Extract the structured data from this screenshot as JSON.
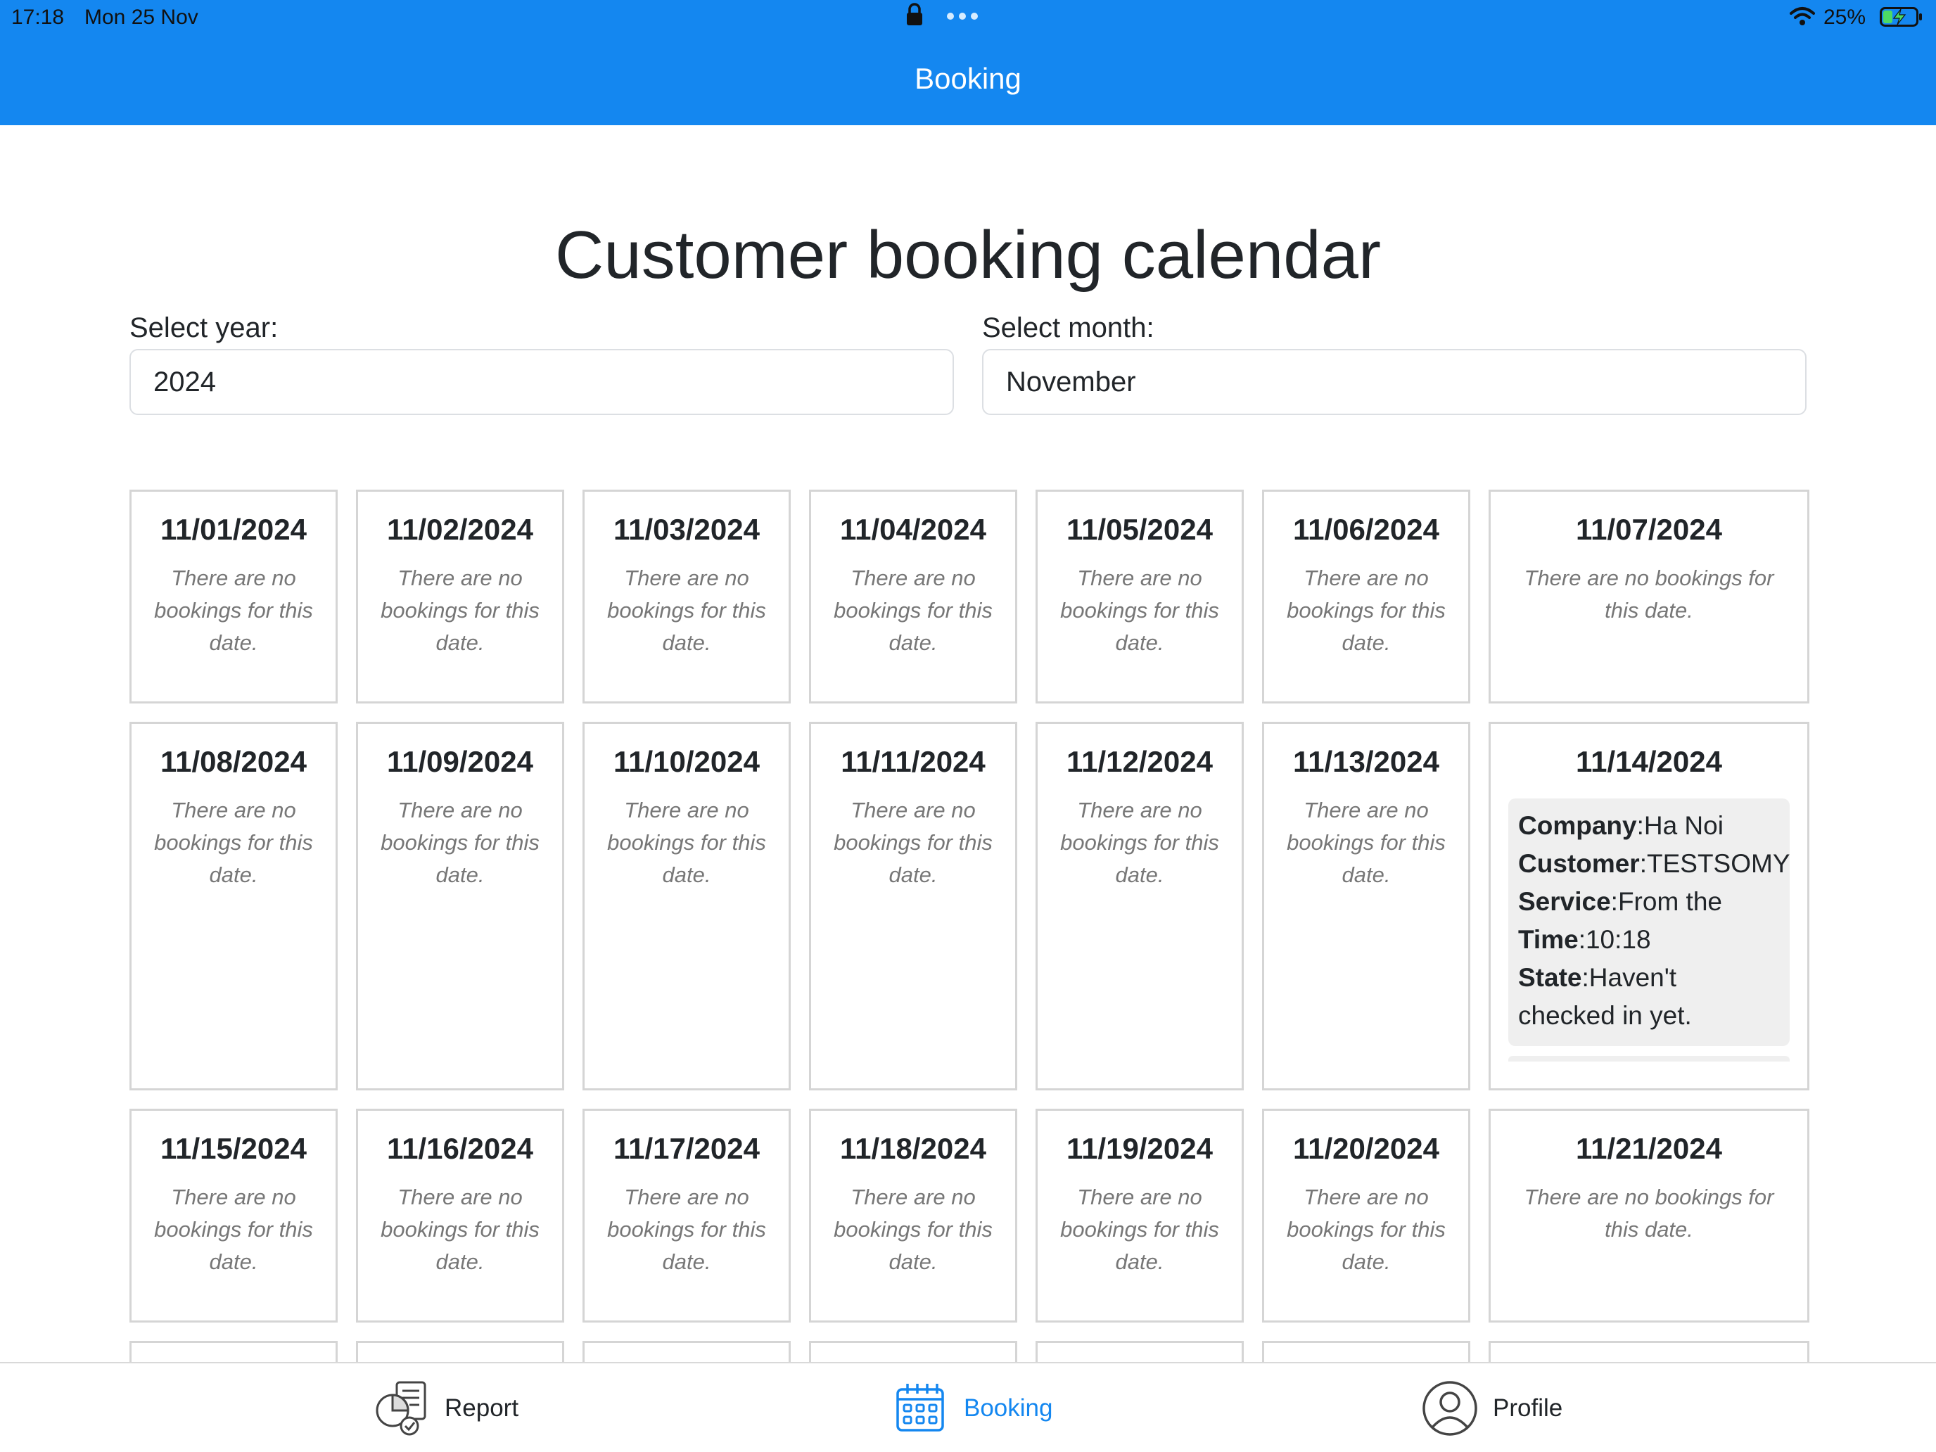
{
  "status_bar": {
    "time": "17:18",
    "date": "Mon 25 Nov",
    "battery": "25%"
  },
  "nav": {
    "title": "Booking"
  },
  "page": {
    "title": "Customer booking calendar",
    "year_label": "Select year:",
    "year_value": "2024",
    "month_label": "Select month:",
    "month_value": "November"
  },
  "calendar": {
    "empty_text": "There are no bookings for this date.",
    "days": [
      {
        "date": "11/01/2024"
      },
      {
        "date": "11/02/2024"
      },
      {
        "date": "11/03/2024"
      },
      {
        "date": "11/04/2024"
      },
      {
        "date": "11/05/2024"
      },
      {
        "date": "11/06/2024"
      },
      {
        "date": "11/07/2024"
      },
      {
        "date": "11/08/2024"
      },
      {
        "date": "11/09/2024"
      },
      {
        "date": "11/10/2024"
      },
      {
        "date": "11/11/2024"
      },
      {
        "date": "11/12/2024"
      },
      {
        "date": "11/13/2024"
      },
      {
        "date": "11/14/2024",
        "booking": {
          "company_label": "Company",
          "company": "Ha Noi",
          "customer_label": "Customer",
          "customer": "TESTSOMY",
          "service_label": "Service",
          "service": "From the",
          "time_label": "Time",
          "time": "10:18",
          "state_label": "State",
          "state": "Haven't checked in yet."
        }
      },
      {
        "date": "11/15/2024"
      },
      {
        "date": "11/16/2024"
      },
      {
        "date": "11/17/2024"
      },
      {
        "date": "11/18/2024"
      },
      {
        "date": "11/19/2024"
      },
      {
        "date": "11/20/2024"
      },
      {
        "date": "11/21/2024"
      }
    ]
  },
  "tabs": {
    "report": "Report",
    "booking": "Booking",
    "profile": "Profile"
  },
  "colors": {
    "accent": "#1487F0",
    "text": "#212529",
    "muted": "#777777",
    "card_border": "#d5d5d5",
    "booking_bg": "#efefef"
  }
}
